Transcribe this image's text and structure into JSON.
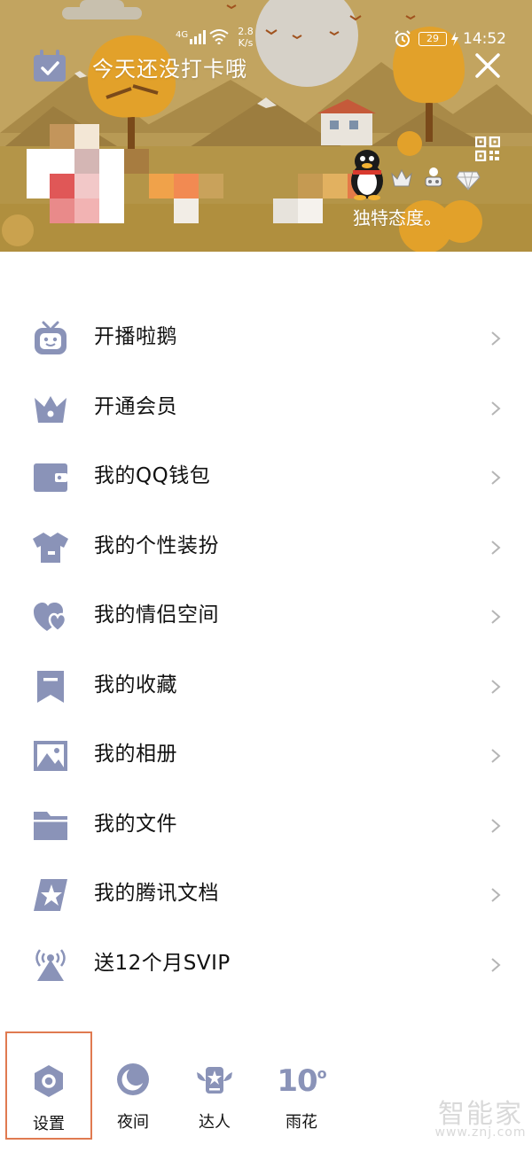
{
  "status_bar": {
    "network_type": "4G",
    "net_speed_value": "2.8",
    "net_speed_unit": "K/s",
    "battery_level": "29",
    "time": "14:52"
  },
  "header": {
    "checkin_text": "今天还没打卡哦",
    "signature_text": "独特态度。",
    "theme_colors": {
      "sky": "#b89a55",
      "sun": "#d6d1c8",
      "tree": "#e2a12a"
    }
  },
  "menu": {
    "items": [
      {
        "label": "开播啦鹅",
        "icon": "tv-robot-icon"
      },
      {
        "label": "开通会员",
        "icon": "crown-icon"
      },
      {
        "label": "我的QQ钱包",
        "icon": "wallet-icon"
      },
      {
        "label": "我的个性装扮",
        "icon": "shirt-icon"
      },
      {
        "label": "我的情侣空间",
        "icon": "couple-hearts-icon"
      },
      {
        "label": "我的收藏",
        "icon": "bookmark-icon"
      },
      {
        "label": "我的相册",
        "icon": "photo-icon"
      },
      {
        "label": "我的文件",
        "icon": "folder-icon"
      },
      {
        "label": "我的腾讯文档",
        "icon": "doc-star-icon"
      },
      {
        "label": "送12个月SVIP",
        "icon": "broadcast-icon"
      }
    ],
    "icon_color": "#8a93b8",
    "chevron_color": "#b5b5b5"
  },
  "bottom_bar": {
    "settings_label": "设置",
    "night_label": "夜间",
    "expert_label": "达人",
    "weather_temp": "10",
    "weather_degree": "o",
    "weather_label": "雨花",
    "highlight_color": "#e07a50"
  },
  "watermark": {
    "title": "智能家",
    "url": "www.znj.com"
  }
}
